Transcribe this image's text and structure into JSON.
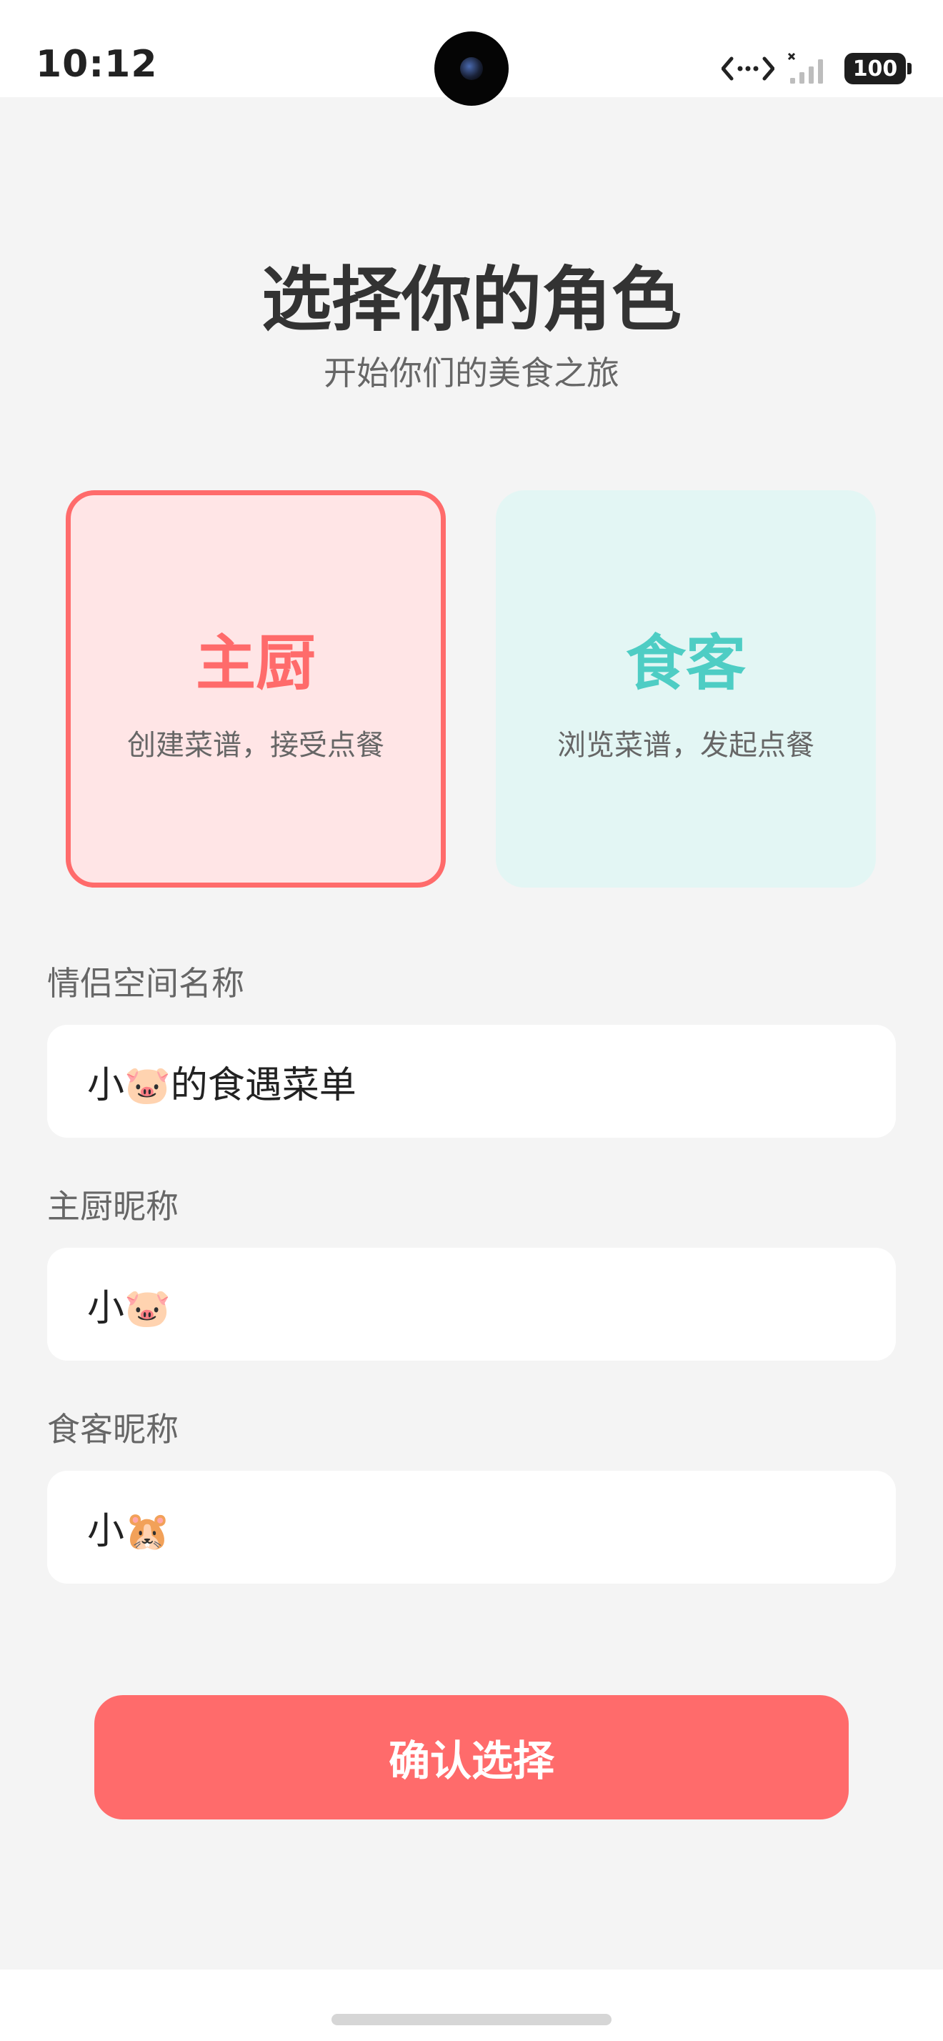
{
  "status_bar": {
    "time": "10:12",
    "battery": "100",
    "icons": [
      "nfc-icon",
      "signal-icon",
      "battery-icon"
    ]
  },
  "header": {
    "title": "选择你的角色",
    "subtitle": "开始你们的美食之旅"
  },
  "roles": [
    {
      "title": "主厨",
      "desc": "创建菜谱，接受点餐",
      "selected": true,
      "color": "#ff6b6b",
      "bg": "#ffe5e6"
    },
    {
      "title": "食客",
      "desc": "浏览菜谱，发起点餐",
      "selected": false,
      "color": "#4ecdc4",
      "bg": "#e3f6f4"
    }
  ],
  "form": {
    "space_name": {
      "label": "情侣空间名称",
      "value": "小🐷的食遇菜单"
    },
    "chef_nickname": {
      "label": "主厨昵称",
      "value": "小🐷"
    },
    "diner_nickname": {
      "label": "食客昵称",
      "value": "小🐹"
    }
  },
  "confirm_button": {
    "label": "确认选择",
    "color": "#ff6b6b"
  }
}
